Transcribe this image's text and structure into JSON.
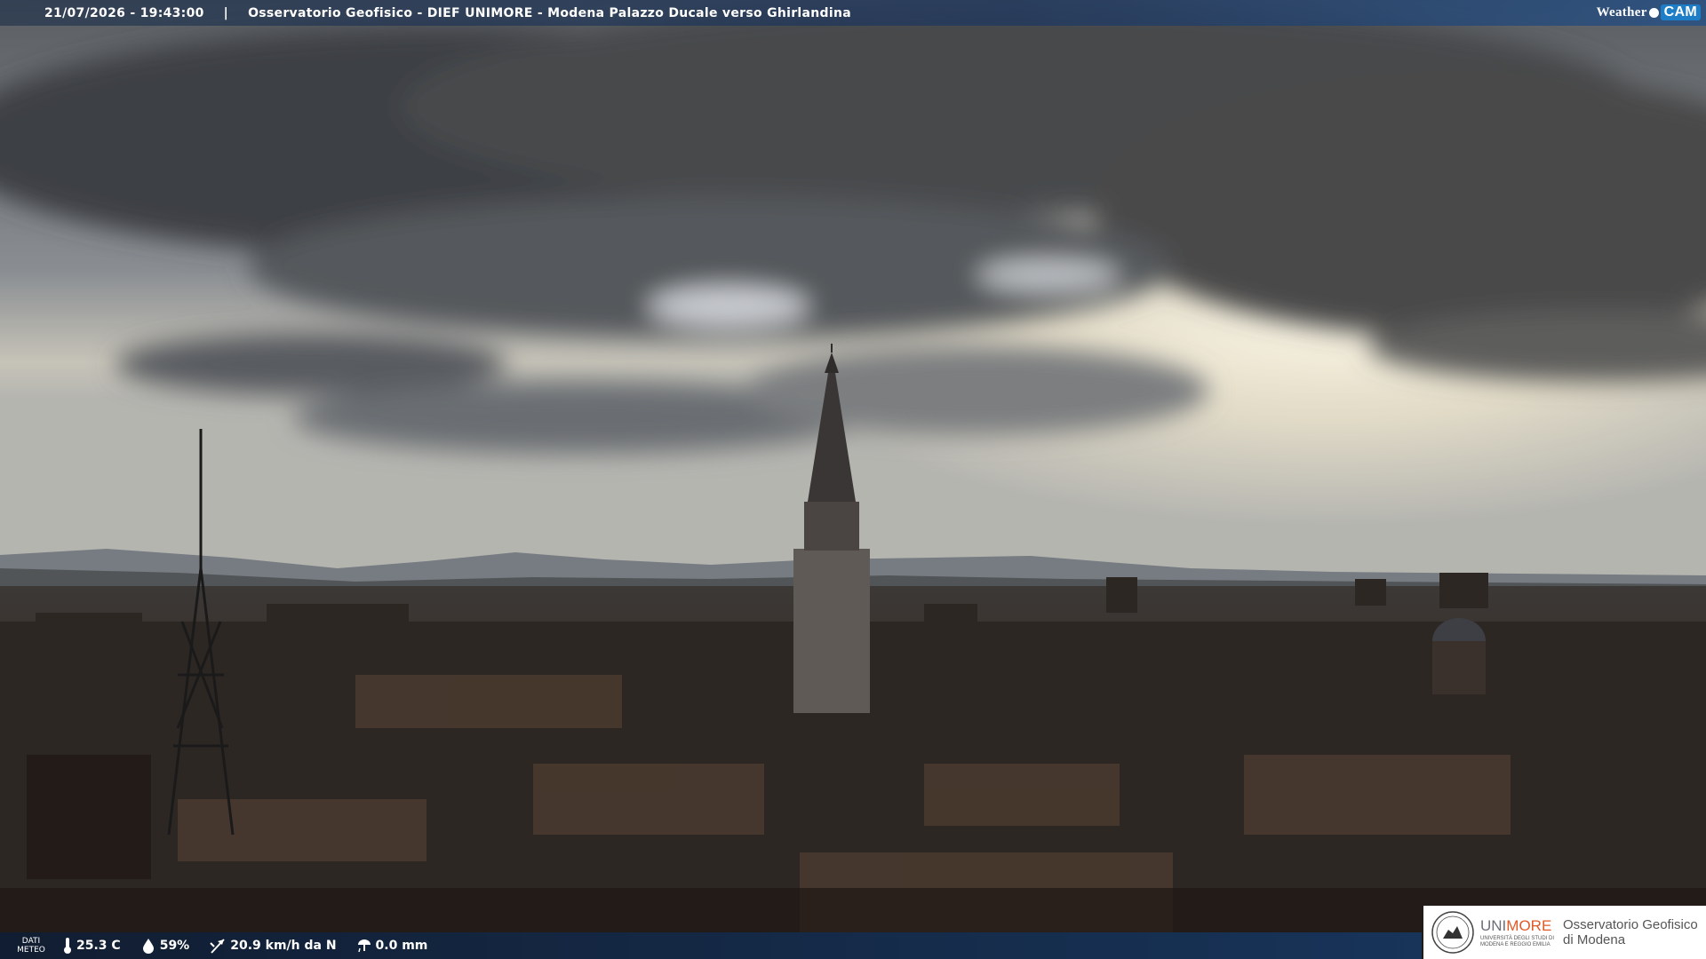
{
  "overlay": {
    "timestamp": "21/07/2026 - 19:43:00",
    "separator": "|",
    "caption": "Osservatorio Geofisico - DIEF UNIMORE - Modena Palazzo Ducale verso Ghirlandina",
    "logo_weather": "Weather",
    "logo_cam": "CAM"
  },
  "weather": {
    "label_line1": "DATI",
    "label_line2": "METEO",
    "temperature": "25.3 C",
    "humidity": "59%",
    "wind": "20.9 km/h da N",
    "rain": "0.0 mm",
    "icons": [
      "thermometer-icon",
      "humidity-drop-icon",
      "wind-vane-icon",
      "rain-gauge-icon"
    ]
  },
  "institution": {
    "name_grey": "UNI",
    "name_orange": "MORE",
    "subtitle_line1": "UNIVERSITÀ DEGLI STUDI DI",
    "subtitle_line2": "MODENA E REGGIO EMILIA",
    "observatory_line1": "Osservatorio Geofisico",
    "observatory_line2": "di Modena"
  },
  "colors": {
    "sky_light": "#efeadc",
    "cloud_dark": "#3e4044",
    "city_dark": "#2e2622",
    "accent_orange": "#e05a26",
    "bar_blue": "#1e3c6e"
  }
}
